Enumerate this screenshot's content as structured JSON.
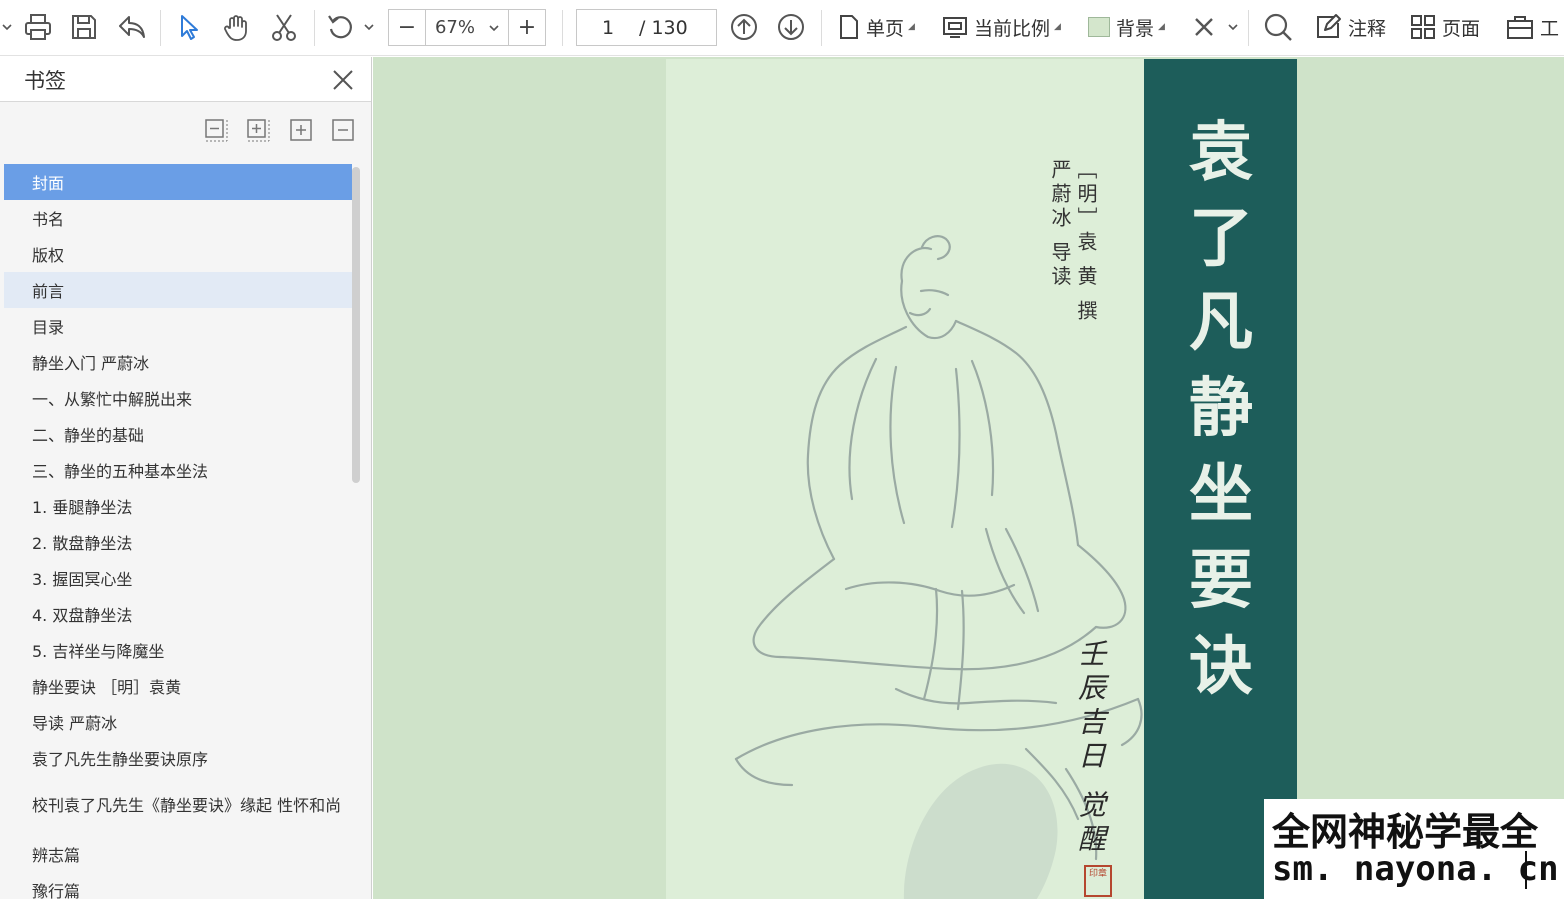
{
  "toolbar": {
    "zoom": {
      "value": "67%",
      "minus": "−",
      "plus": "+"
    },
    "page": {
      "current": "1",
      "total": "/ 130"
    },
    "single_page": "单页",
    "fit_ratio": "当前比例",
    "background": "背景",
    "annotate": "注释",
    "pages": "页面",
    "tools": "工",
    "icons": [
      "print-icon",
      "save-icon",
      "undo-icon",
      "select-icon",
      "hand-icon",
      "cut-icon",
      "rotate-icon",
      "zoom-out-icon",
      "zoom-in-icon",
      "prev-page-icon",
      "next-page-icon",
      "page-icon",
      "fit-icon",
      "close-icon",
      "search-icon",
      "annotate-icon",
      "pages-icon",
      "tools-icon"
    ],
    "accent_color": "#6a9ee6"
  },
  "sidebar": {
    "title": "书签",
    "items": [
      {
        "label": "封面",
        "state": "selected"
      },
      {
        "label": "书名"
      },
      {
        "label": "版权"
      },
      {
        "label": "前言",
        "state": "hover"
      },
      {
        "label": "目录"
      },
      {
        "label": "静坐入门  严蔚冰"
      },
      {
        "label": "一、从繁忙中解脱出来"
      },
      {
        "label": "二、静坐的基础"
      },
      {
        "label": "三、静坐的五种基本坐法"
      },
      {
        "label": "1. 垂腿静坐法"
      },
      {
        "label": "2. 散盘静坐法"
      },
      {
        "label": "3. 握固冥心坐"
      },
      {
        "label": "4. 双盘静坐法"
      },
      {
        "label": "5. 吉祥坐与降魔坐"
      },
      {
        "label": "静坐要诀 ［明］袁黄"
      },
      {
        "label": "导读  严蔚冰"
      },
      {
        "label": "袁了凡先生静坐要诀原序"
      },
      {
        "label": "校刊袁了凡先生《静坐要诀》缘起  性怀和尚"
      },
      {
        "label": "辨志篇"
      },
      {
        "label": "豫行篇"
      }
    ]
  },
  "cover": {
    "title_chars": [
      "袁",
      "了",
      "凡",
      "静",
      "坐",
      "要",
      "诀"
    ],
    "author_line1": "［明］袁 黄 撰",
    "author_line2": "严蔚冰 导读",
    "calligraphy": "壬辰吉日 觉醒",
    "seal": "印章",
    "colors": {
      "spine": "#1d5d5a",
      "paper": "#ddeed8",
      "background": "#cfe3c9"
    }
  },
  "watermark": {
    "line1": "全网神秘学最全",
    "line2": "sm. nayona. cn"
  }
}
